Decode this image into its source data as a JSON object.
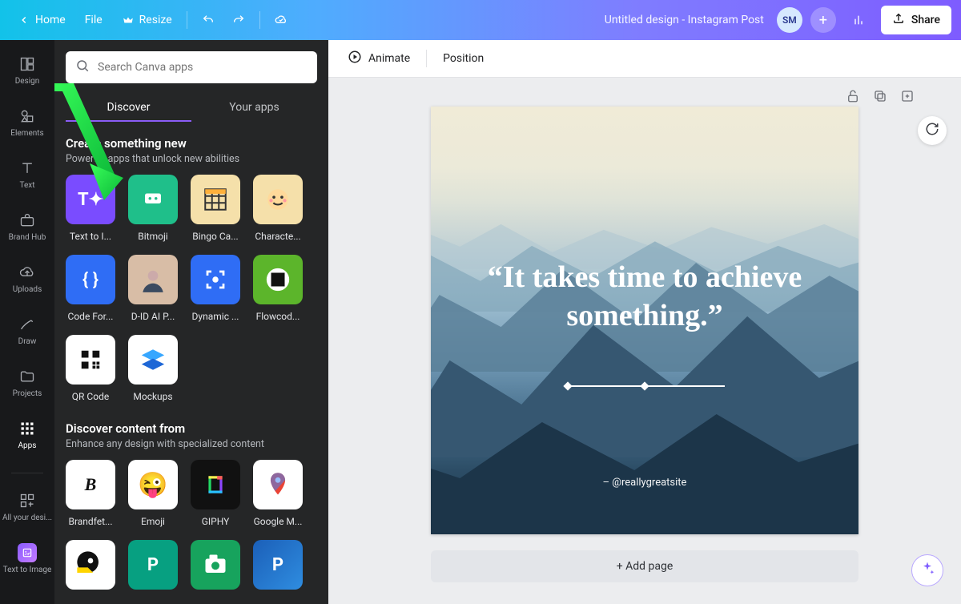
{
  "topbar": {
    "back_home": "Home",
    "file": "File",
    "resize": "Resize",
    "doc_title": "Untitled design - Instagram Post",
    "avatar_initials": "SM",
    "share": "Share"
  },
  "rail": {
    "design": "Design",
    "elements": "Elements",
    "text": "Text",
    "brand_hub": "Brand Hub",
    "uploads": "Uploads",
    "draw": "Draw",
    "projects": "Projects",
    "apps": "Apps",
    "all_designs": "All your desi...",
    "text_to_image": "Text to Image"
  },
  "panel": {
    "search_placeholder": "Search Canva apps",
    "tabs": {
      "discover": "Discover",
      "your_apps": "Your apps"
    },
    "create": {
      "title": "Create something new",
      "subtitle": "Powerful apps that unlock new abilities",
      "apps": [
        {
          "label": "Text to I..."
        },
        {
          "label": "Bitmoji"
        },
        {
          "label": "Bingo Ca..."
        },
        {
          "label": "Characte..."
        },
        {
          "label": "Code For..."
        },
        {
          "label": "D-ID AI P..."
        },
        {
          "label": "Dynamic ..."
        },
        {
          "label": "Flowcod..."
        },
        {
          "label": "QR Code"
        },
        {
          "label": "Mockups"
        }
      ]
    },
    "content": {
      "title": "Discover content from",
      "subtitle": "Enhance any design with specialized content",
      "apps": [
        {
          "label": "Brandfet..."
        },
        {
          "label": "Emoji"
        },
        {
          "label": "GIPHY"
        },
        {
          "label": "Google M..."
        }
      ]
    }
  },
  "actionbar": {
    "animate": "Animate",
    "position": "Position"
  },
  "canvas": {
    "quote": "“It takes time to achieve something.”",
    "credit": "– @reallygreatsite",
    "add_page": "+ Add page"
  }
}
